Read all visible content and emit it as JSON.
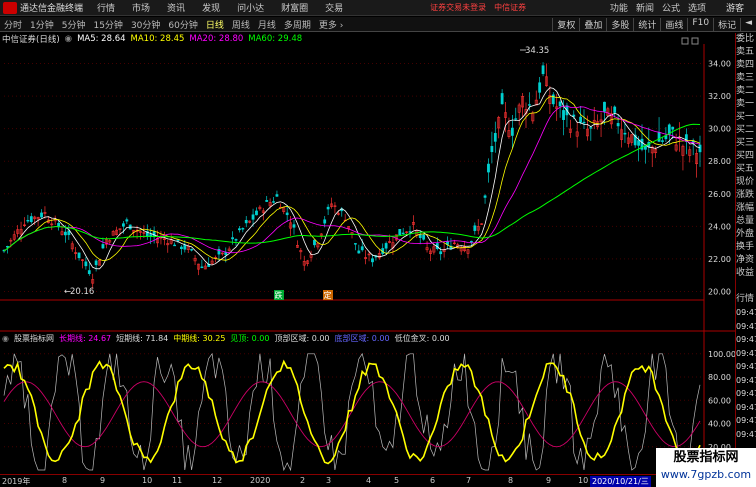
{
  "menubar": {
    "app_name": "通达信金融终端",
    "items": [
      "行情",
      "市场",
      "资讯",
      "发现",
      "问小达",
      "财富圈",
      "交易"
    ],
    "alert": "证券交易未登录",
    "alert2": "中信证券",
    "right_items": [
      "功能",
      "新闻",
      "公式",
      "选项"
    ],
    "guest": "游客"
  },
  "toolbar": {
    "periods": [
      "分时",
      "1分钟",
      "5分钟",
      "15分钟",
      "30分钟",
      "60分钟",
      "日线",
      "周线",
      "月线",
      "多周期",
      "更多 ›"
    ],
    "selected": "日线",
    "tools": [
      "复权",
      "叠加",
      "多股",
      "统计",
      "画线",
      "F10",
      "标记",
      "◄"
    ]
  },
  "legend": {
    "stock": "中信证券(日线)",
    "ma5_label": "MA5: 28.64",
    "ma10_label": "MA10: 28.45",
    "ma20_label": "MA20: 28.80",
    "ma60_label": "MA60: 29.48",
    "colors": {
      "ma5": "#ffffff",
      "ma10": "#ffff00",
      "ma20": "#ff00ff",
      "ma60": "#00ff00"
    }
  },
  "annotations": {
    "high": "34.35",
    "low": "20.16",
    "signal1": "跌",
    "signal2": "定"
  },
  "indicator": {
    "name": "股票指标网",
    "long": "长期线: 24.67",
    "short": "短期线: 71.84",
    "mid": "中期线: 30.25",
    "see_top": "见顶: 0.00",
    "top_zone": "顶部区域: 0.00",
    "bottom_zone": "底部区域: 0.00",
    "gold_cross": "低位金叉: 0.00",
    "y_ticks": [
      "100.00",
      "80.00",
      "60.00",
      "40.00",
      "20.00"
    ]
  },
  "quote_panel": {
    "labels": [
      "委比",
      "卖五",
      "卖四",
      "卖三",
      "卖二",
      "卖一",
      "买一",
      "买二",
      "买三",
      "买四",
      "买五",
      "现价",
      "涨跌",
      "涨幅",
      "总量",
      "外盘",
      "换手",
      "净资",
      "收益",
      "",
      "行情"
    ],
    "times": [
      "09:47",
      "09:47",
      "09:47",
      "09:47",
      "09:47",
      "09:47",
      "09:47",
      "09:47",
      "09:47",
      "09:47"
    ]
  },
  "xaxis": {
    "labels": [
      "2019年",
      "8",
      "9",
      "10",
      "11",
      "12",
      "2020",
      "2",
      "3",
      "4",
      "5",
      "6",
      "7",
      "8",
      "9",
      "10",
      "2020/10/21/三"
    ]
  },
  "watermark": {
    "title": "股票指标网",
    "url": "www.7gpzb.com"
  },
  "chart_data": {
    "type": "line",
    "title": "中信证券(日线)",
    "y_ticks": [
      34.0,
      32.0,
      30.0,
      28.0,
      26.0,
      24.0,
      22.0,
      20.0
    ],
    "ylim": [
      19.6,
      35.2
    ],
    "anchors": [
      [
        0,
        22.5
      ],
      [
        6,
        24.3
      ],
      [
        12,
        24.8
      ],
      [
        18,
        23.6
      ],
      [
        22,
        22.2
      ],
      [
        26,
        21.0
      ],
      [
        30,
        23.2
      ],
      [
        36,
        24.2
      ],
      [
        42,
        23.4
      ],
      [
        48,
        23.2
      ],
      [
        54,
        22.6
      ],
      [
        58,
        21.5
      ],
      [
        64,
        22.2
      ],
      [
        70,
        23.8
      ],
      [
        76,
        25.2
      ],
      [
        80,
        25.8
      ],
      [
        84,
        24.4
      ],
      [
        88,
        21.8
      ],
      [
        92,
        23.2
      ],
      [
        96,
        25.4
      ],
      [
        100,
        24.6
      ],
      [
        104,
        22.4
      ],
      [
        108,
        22.0
      ],
      [
        112,
        22.8
      ],
      [
        116,
        23.6
      ],
      [
        120,
        24.0
      ],
      [
        124,
        22.6
      ],
      [
        128,
        22.4
      ],
      [
        132,
        23.0
      ],
      [
        136,
        22.8
      ],
      [
        140,
        24.3
      ],
      [
        143,
        28.5
      ],
      [
        146,
        31.0
      ],
      [
        149,
        30.0
      ],
      [
        152,
        31.8
      ],
      [
        155,
        31.2
      ],
      [
        158,
        33.2
      ],
      [
        161,
        31.6
      ],
      [
        164,
        30.8
      ],
      [
        168,
        30.2
      ],
      [
        172,
        29.8
      ],
      [
        176,
        30.8
      ],
      [
        180,
        30.4
      ],
      [
        184,
        29.5
      ],
      [
        188,
        28.5
      ],
      [
        192,
        29.2
      ],
      [
        196,
        29.6
      ],
      [
        200,
        28.8
      ],
      [
        204,
        28.6
      ]
    ]
  }
}
